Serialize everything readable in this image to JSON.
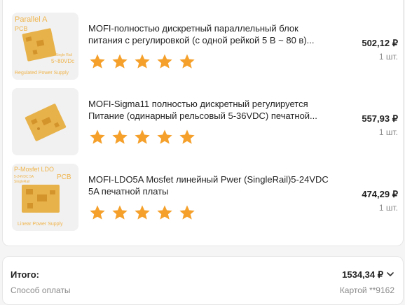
{
  "colors": {
    "star": "#f5a02a",
    "pcb": "#e8b24a",
    "thumb_bg": "#f1f1f1",
    "thumb_text": "#f0b44c"
  },
  "items": [
    {
      "title": "MOFI-полностью дискретный параллельный блок питания с регулировкой (с одной рейкой 5 В ~ 80 в)...",
      "price": "502,12 ₽",
      "qty": "1 шт.",
      "rating": 5,
      "thumb": {
        "top_text": "Parallel A",
        "sub_text": "PCB",
        "side_text": "5~80VDc",
        "side_small": "Single Rail",
        "bottom_text": "Regulated Power Supply"
      }
    },
    {
      "title": "MOFI-Sigma11 полностью дискретный регулируется Питание (одинарный рельсовый 5-36VDC) печатной...",
      "price": "557,93 ₽",
      "qty": "1 шт.",
      "rating": 5,
      "thumb": {}
    },
    {
      "title": "MOFI-LDO5A Mosfet линейный Pwer (SingleRail)5-24VDC 5A печатной платы",
      "price": "474,29 ₽",
      "qty": "1 шт.",
      "rating": 5,
      "thumb": {
        "top_text": "P-Mosfet LDO",
        "sub_text": "5-24VDC 5A",
        "sub_text2": "SingleRail",
        "side_text": "PCB",
        "bottom_text": "Linear Power Supply"
      }
    }
  ],
  "summary": {
    "total_label": "Итого:",
    "total_value": "1534,34 ₽",
    "payment_label": "Способ оплаты",
    "payment_value": "Картой **9162"
  }
}
